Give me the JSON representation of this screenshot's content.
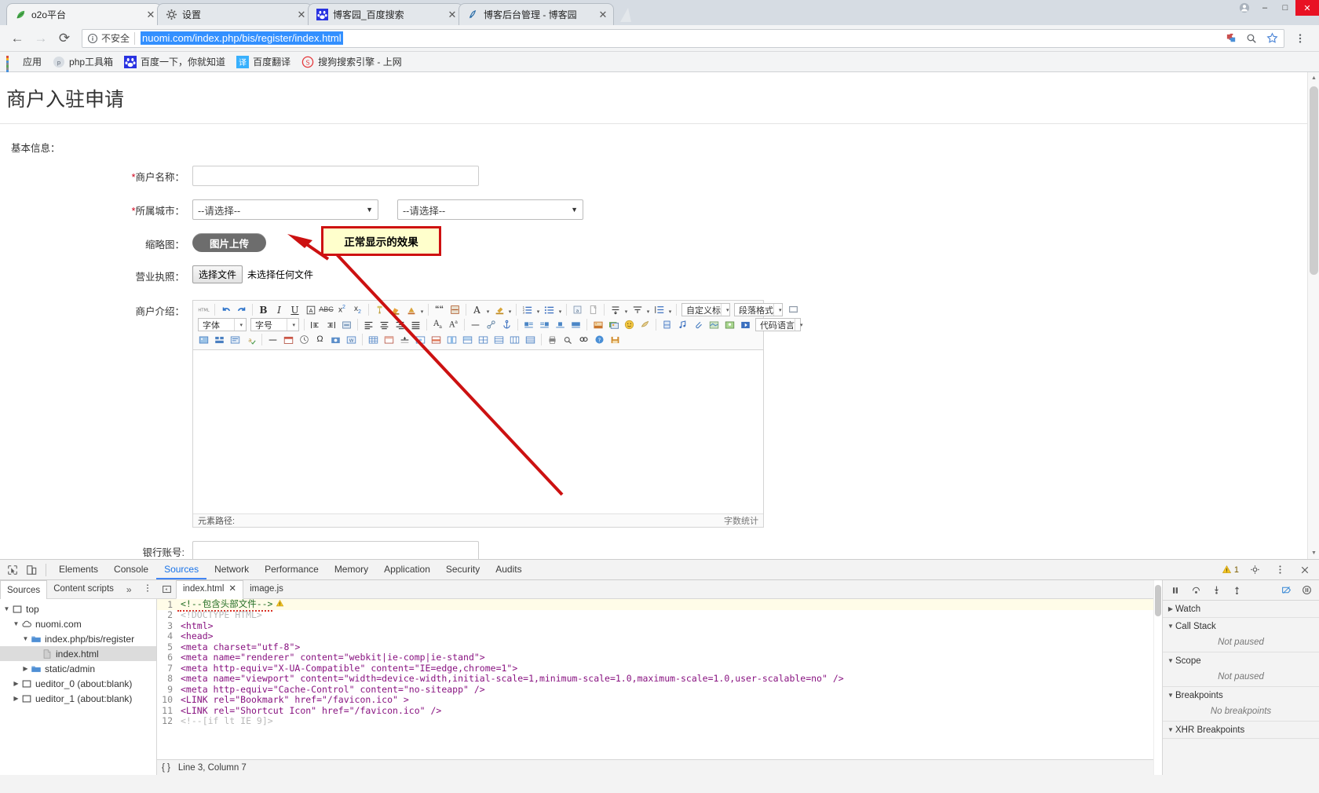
{
  "window": {
    "controls": {
      "user": "user-icon",
      "minimize": "–",
      "maximize": "□",
      "close": "✕"
    }
  },
  "tabs": [
    {
      "title": "o2o平台",
      "favicon": "leaf-green-icon",
      "active": true,
      "close": "✕"
    },
    {
      "title": "设置",
      "favicon": "gear-icon",
      "active": false,
      "close": "✕"
    },
    {
      "title": "博客园_百度搜索",
      "favicon": "baidu-paw-icon",
      "active": false,
      "close": "✕"
    },
    {
      "title": "博客后台管理 - 博客园",
      "favicon": "cnblogs-icon",
      "active": false,
      "close": "✕"
    }
  ],
  "toolbar": {
    "back": "←",
    "forward": "→",
    "reload": "⟳",
    "security_icon": "info-circle-icon",
    "security_text": "不安全",
    "url": "nuomi.com/index.php/bis/register/index.html",
    "extension_icon": "puzzle-icon",
    "search_icon": "magnifier-icon",
    "bookmark_icon": "star-icon",
    "menu_icon": "three-dot-menu-icon"
  },
  "bookmarks": [
    {
      "label": "应用",
      "icon": "apps-grid-icon"
    },
    {
      "label": "php工具箱",
      "icon": "php-icon"
    },
    {
      "label": "百度一下，你就知道",
      "icon": "baidu-paw-icon"
    },
    {
      "label": "百度翻译",
      "icon": "translate-icon"
    },
    {
      "label": "搜狗搜索引擎 - 上网",
      "icon": "sogou-icon"
    }
  ],
  "page": {
    "title": "商户入驻申请",
    "section_label": "基本信息：",
    "fields": {
      "merchant_name": {
        "label": "商户名称：",
        "required": true,
        "value": ""
      },
      "city": {
        "label": "所属城市：",
        "required": true,
        "select1": "--请选择--",
        "select2": "--请选择--",
        "caret": "▼"
      },
      "thumbnail": {
        "label": "缩略图：",
        "required": false,
        "button": "图片上传"
      },
      "license": {
        "label": "营业执照：",
        "required": false,
        "choose_button": "选择文件",
        "file_status": "未选择任何文件"
      },
      "intro": {
        "label": "商户介绍：",
        "required": false
      },
      "bank_account": {
        "label": "银行账号:",
        "required": false,
        "value": ""
      }
    },
    "editor": {
      "font_family_placeholder": "字体",
      "font_size_placeholder": "字号",
      "custom_style": "自定义标",
      "paragraph_format": "段落格式",
      "code_language": "代码语言",
      "statusbar_path": "元素路径:",
      "statusbar_wordcount": "字数统计",
      "row1_icons": [
        "html-source-icon",
        "undo-icon",
        "redo-icon",
        "bold-icon",
        "italic-icon",
        "underline-icon",
        "remove-format-icon",
        "strikethrough-icon",
        "superscript-icon",
        "subscript-icon",
        "format-painter-icon",
        "highlight-icon",
        "text-color-icon",
        "blockquote-icon",
        "page-break-icon",
        "font-color-icon",
        "background-color-icon",
        "ordered-list-icon",
        "unordered-list-icon",
        "insert-code-icon",
        "paste-plain-icon",
        "line-height-icon",
        "paragraph-spacing-icon",
        "indent-spacing-icon"
      ],
      "row2_icons": [
        "indent-increase-icon",
        "indent-decrease-icon",
        "direction-icon",
        "align-left-icon",
        "align-center-icon",
        "align-right-icon",
        "align-justify-icon",
        "case-upper-icon",
        "case-lower-icon",
        "horizontal-rule-icon",
        "unlink-icon",
        "anchor-icon",
        "img-left-icon",
        "img-right-icon",
        "img-center-icon",
        "img-none-icon",
        "insert-image-icon",
        "image-gallery-icon",
        "emotion-icon",
        "webapp-icon",
        "insert-video-icon",
        "music-icon",
        "attachment-icon",
        "map-icon",
        "baidu-map-icon",
        "flash-icon"
      ],
      "row3_icons": [
        "background-icon",
        "template-icon",
        "search-replace-icon",
        "spellcheck-icon",
        "horizontal-line-icon",
        "date-icon",
        "time-icon",
        "special-char-icon",
        "snapshot-icon",
        "wordimage-icon",
        "insert-table-icon",
        "table-prop-icon",
        "row-prop-icon",
        "cell-prop-icon",
        "insert-row-icon",
        "insert-col-icon",
        "merge-cells-icon",
        "split-cells-icon",
        "delete-row-icon",
        "delete-col-icon",
        "table-sort-icon",
        "print-icon",
        "preview-icon",
        "search-icon",
        "help-icon",
        "save-icon"
      ]
    }
  },
  "annotation": {
    "callout_text": "正常显示的效果",
    "arrow_color": "#cc1111",
    "callout_bg": "#ffffcc",
    "callout_border": "#ce1111"
  },
  "devtools": {
    "inspect_icon": "inspect-element-icon",
    "device_icon": "device-toolbar-icon",
    "tabs": [
      "Elements",
      "Console",
      "Sources",
      "Network",
      "Performance",
      "Memory",
      "Application",
      "Security",
      "Audits"
    ],
    "active_tab": "Sources",
    "warning_count": "1",
    "settings_icon": "gear-icon",
    "more_icon": "three-dot-menu-icon",
    "close_icon": "close-icon",
    "subtabs": [
      "Sources",
      "Content scripts"
    ],
    "subtabs_overflow": "»",
    "active_subtab": "Sources",
    "tree": [
      {
        "label": "top",
        "icon": "frame-icon",
        "depth": 0,
        "arrow": "▼",
        "selected": false
      },
      {
        "label": "nuomi.com",
        "icon": "cloud-icon",
        "depth": 1,
        "arrow": "▼",
        "selected": false
      },
      {
        "label": "index.php/bis/register",
        "icon": "folder-icon",
        "depth": 2,
        "arrow": "▼",
        "selected": false
      },
      {
        "label": "index.html",
        "icon": "file-icon",
        "depth": 3,
        "arrow": "",
        "selected": true
      },
      {
        "label": "static/admin",
        "icon": "folder-icon",
        "depth": 2,
        "arrow": "▶",
        "selected": false
      },
      {
        "label": "ueditor_0 (about:blank)",
        "icon": "frame-icon",
        "depth": 1,
        "arrow": "▶",
        "selected": false
      },
      {
        "label": "ueditor_1 (about:blank)",
        "icon": "frame-icon",
        "depth": 1,
        "arrow": "▶",
        "selected": false
      }
    ],
    "file_tabs": [
      {
        "label": "index.html",
        "active": true,
        "close": "✕"
      },
      {
        "label": "image.js",
        "active": false,
        "close": ""
      }
    ],
    "code_lines": [
      {
        "n": "1",
        "text": "<!--包含头部文件-->",
        "kind": "comment-warn",
        "hl": true
      },
      {
        "n": "2",
        "text": "<!DOCTYPE HTML>",
        "kind": "dim"
      },
      {
        "n": "3",
        "text": "<html>",
        "kind": "tag"
      },
      {
        "n": "4",
        "text": "<head>",
        "kind": "tag"
      },
      {
        "n": "5",
        "text": "<meta charset=\"utf-8\">",
        "kind": "tag"
      },
      {
        "n": "6",
        "text": "<meta name=\"renderer\" content=\"webkit|ie-comp|ie-stand\">",
        "kind": "tag"
      },
      {
        "n": "7",
        "text": "<meta http-equiv=\"X-UA-Compatible\" content=\"IE=edge,chrome=1\">",
        "kind": "tag"
      },
      {
        "n": "8",
        "text": "<meta name=\"viewport\" content=\"width=device-width,initial-scale=1,minimum-scale=1.0,maximum-scale=1.0,user-scalable=no\" />",
        "kind": "tag"
      },
      {
        "n": "9",
        "text": "<meta http-equiv=\"Cache-Control\" content=\"no-siteapp\" />",
        "kind": "tag"
      },
      {
        "n": "10",
        "text": "<LINK rel=\"Bookmark\" href=\"/favicon.ico\" >",
        "kind": "tag"
      },
      {
        "n": "11",
        "text": "<LINK rel=\"Shortcut Icon\" href=\"/favicon.ico\" />",
        "kind": "tag"
      },
      {
        "n": "12",
        "text": "<!--[if lt IE 9]>",
        "kind": "dim"
      }
    ],
    "code_status": {
      "position": "Line 3, Column 7",
      "format_icon": "{ }"
    },
    "debugger": {
      "pause_icon": "pause-icon",
      "step_over_icon": "step-over-icon",
      "step_into_icon": "step-into-icon",
      "step_out_icon": "step-out-icon",
      "deactivate_icon": "deactivate-breakpoints-icon",
      "pause_exceptions_icon": "pause-on-exceptions-icon"
    },
    "panes": [
      {
        "title": "Watch",
        "arrow": "▶",
        "body": ""
      },
      {
        "title": "Call Stack",
        "arrow": "▼",
        "body": "Not paused"
      },
      {
        "title": "Scope",
        "arrow": "▼",
        "body": "Not paused"
      },
      {
        "title": "Breakpoints",
        "arrow": "▼",
        "body": "No breakpoints"
      },
      {
        "title": "XHR Breakpoints",
        "arrow": "▼",
        "body": ""
      }
    ]
  }
}
